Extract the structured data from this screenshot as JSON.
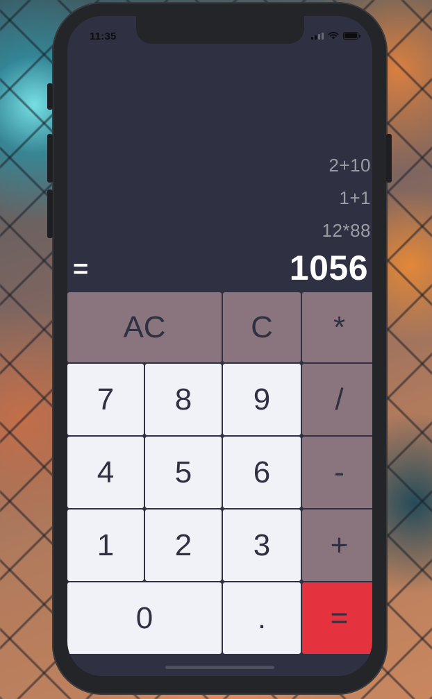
{
  "status_bar": {
    "time": "11:35"
  },
  "display": {
    "history": [
      "2+10",
      "1+1",
      "12*88"
    ],
    "equals_sign": "=",
    "result": "1056"
  },
  "keys": {
    "ac": "AC",
    "c": "C",
    "multiply": "*",
    "seven": "7",
    "eight": "8",
    "nine": "9",
    "divide": "/",
    "four": "4",
    "five": "5",
    "six": "6",
    "minus": "-",
    "one": "1",
    "two": "2",
    "three": "3",
    "plus": "+",
    "zero": "0",
    "dot": ".",
    "equals": "="
  },
  "colors": {
    "screen_bg": "#2f3142",
    "light_key": "#f1f2f7",
    "operator_key": "#8a747d",
    "equals_key": "#e4323f",
    "history_text": "#9b9ba3",
    "result_text": "#ffffff"
  },
  "icons": {
    "signal": "cellular-signal-icon",
    "wifi": "wifi-icon",
    "battery": "battery-icon"
  }
}
